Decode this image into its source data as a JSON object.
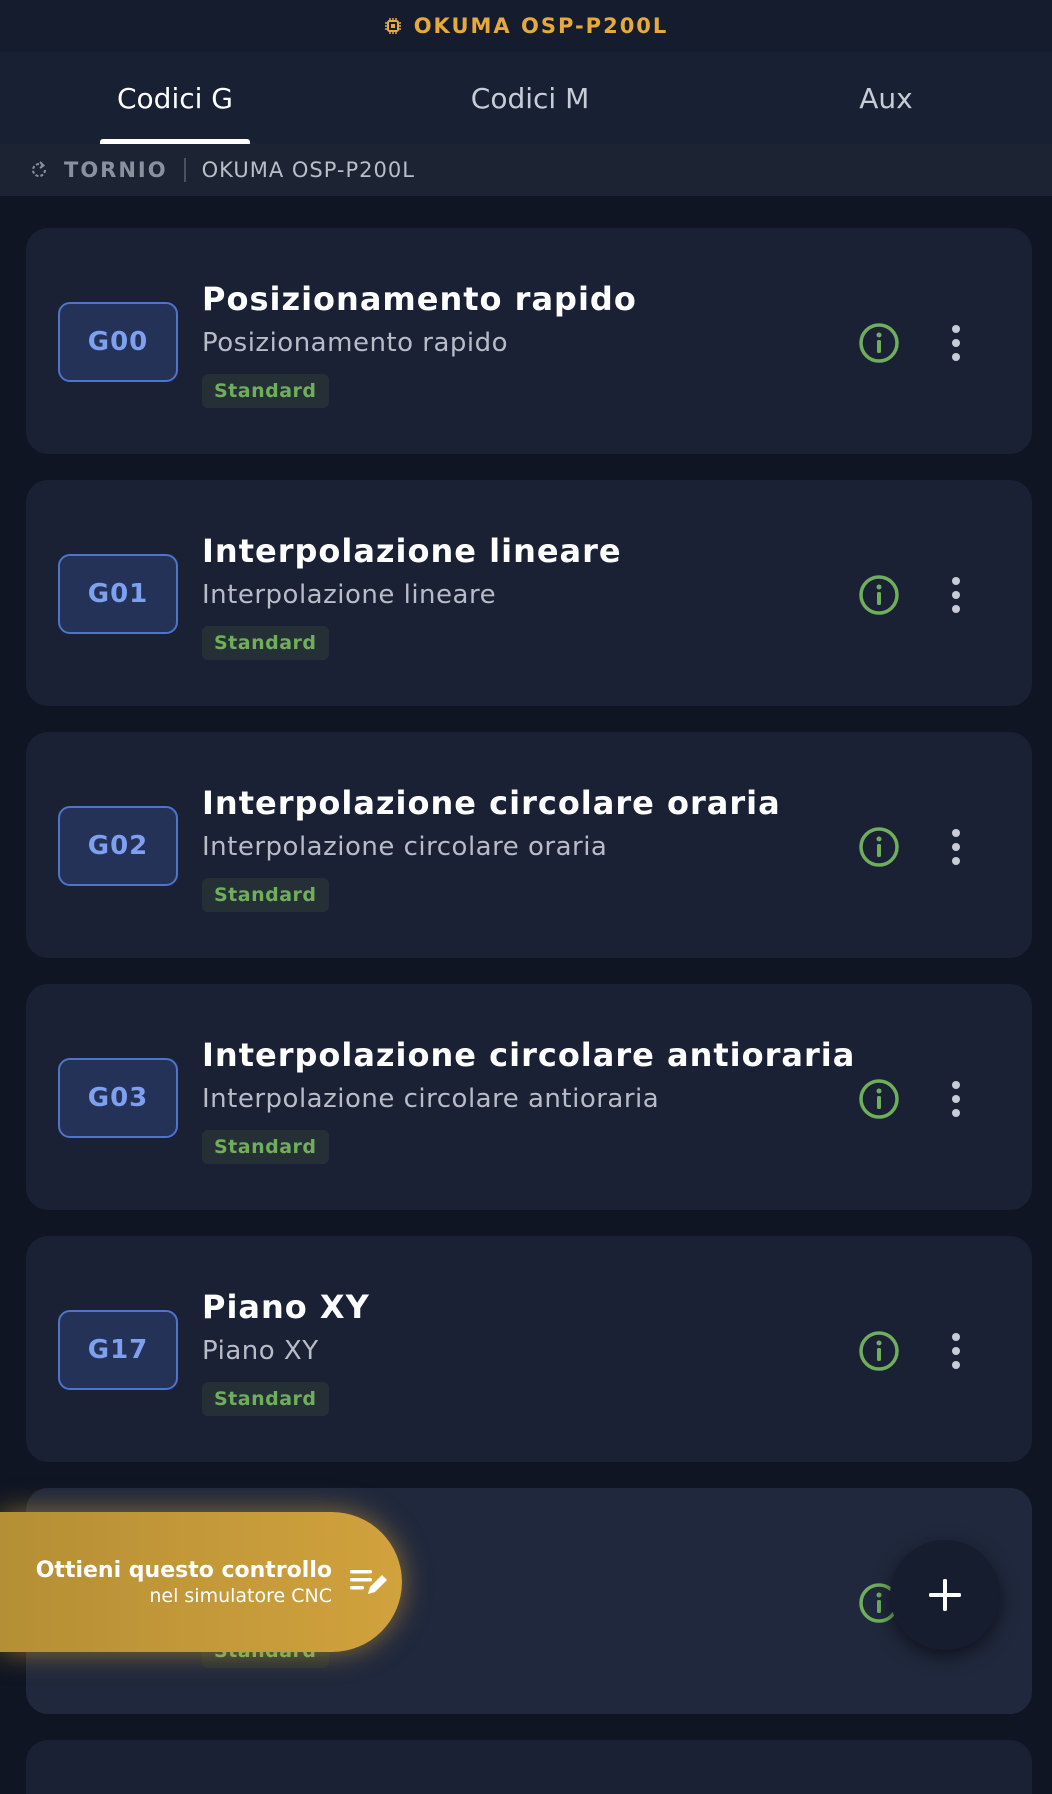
{
  "header": {
    "title": "OKUMA OSP-P200L",
    "icon": "chip-icon",
    "accent": "#e6a93a"
  },
  "tabs": [
    {
      "label": "Codici G",
      "active": true
    },
    {
      "label": "Codici M",
      "active": false
    },
    {
      "label": "Aux",
      "active": false
    }
  ],
  "breadcrumb": {
    "type": "TORNIO",
    "model": "OKUMA OSP-P200L"
  },
  "codes": [
    {
      "code": "G00",
      "title": "Posizionamento rapido",
      "description": "Posizionamento rapido",
      "badge": "Standard"
    },
    {
      "code": "G01",
      "title": "Interpolazione lineare",
      "description": "Interpolazione lineare",
      "badge": "Standard"
    },
    {
      "code": "G02",
      "title": "Interpolazione circolare oraria",
      "description": "Interpolazione circolare oraria",
      "badge": "Standard"
    },
    {
      "code": "G03",
      "title": "Interpolazione circolare antioraria",
      "description": "Interpolazione circolare antioraria",
      "badge": "Standard"
    },
    {
      "code": "G17",
      "title": "Piano XY",
      "description": "Piano XY",
      "badge": "Standard"
    },
    {
      "code": "",
      "title": "",
      "description": "",
      "badge": "Standard"
    }
  ],
  "promo": {
    "line1": "Ottieni questo controllo",
    "line2": "nel simulatore CNC"
  },
  "colors": {
    "badge_text": "#6fae5a",
    "code_text": "#7ea0ee",
    "info_icon": "#6fae5a"
  }
}
